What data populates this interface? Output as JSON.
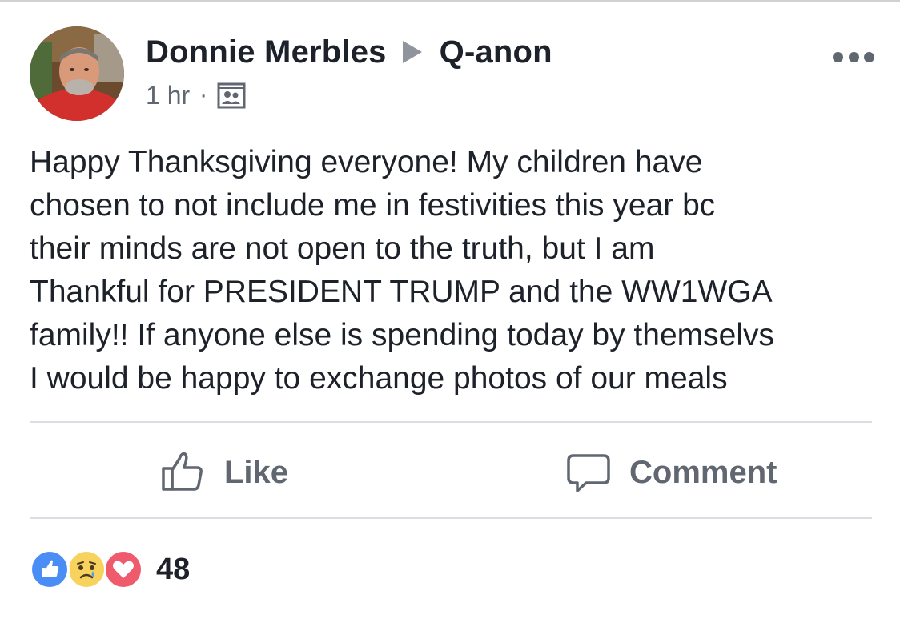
{
  "post": {
    "author": "Donnie Merbles",
    "group": "Q-anon",
    "timestamp": "1 hr",
    "separator": "·",
    "text_lines": [
      "Happy Thanksgiving everyone! My children have",
      "chosen to not include me in festivities this year bc",
      "their minds are not open to the truth, but I am",
      "Thankful for PRESIDENT TRUMP and the WW1WGA",
      "family!! If anyone else is spending today by themselvs",
      "I would be happy to exchange photos of our meals"
    ]
  },
  "actions": {
    "like_label": "Like",
    "comment_label": "Comment"
  },
  "reactions": {
    "types": [
      "like",
      "sad",
      "love"
    ],
    "count": "48"
  },
  "icons": {
    "more": "more-options-icon",
    "arrow": "arrow-right-icon",
    "privacy": "group-audience-icon",
    "like": "thumbs-up-icon",
    "comment": "comment-bubble-icon"
  },
  "colors": {
    "text_primary": "#1d2129",
    "text_secondary": "#606770",
    "like_blue": "#4a8ef5",
    "sad_yellow": "#f7d35d",
    "love_red": "#ef5a6c",
    "divider": "#dadde1"
  }
}
